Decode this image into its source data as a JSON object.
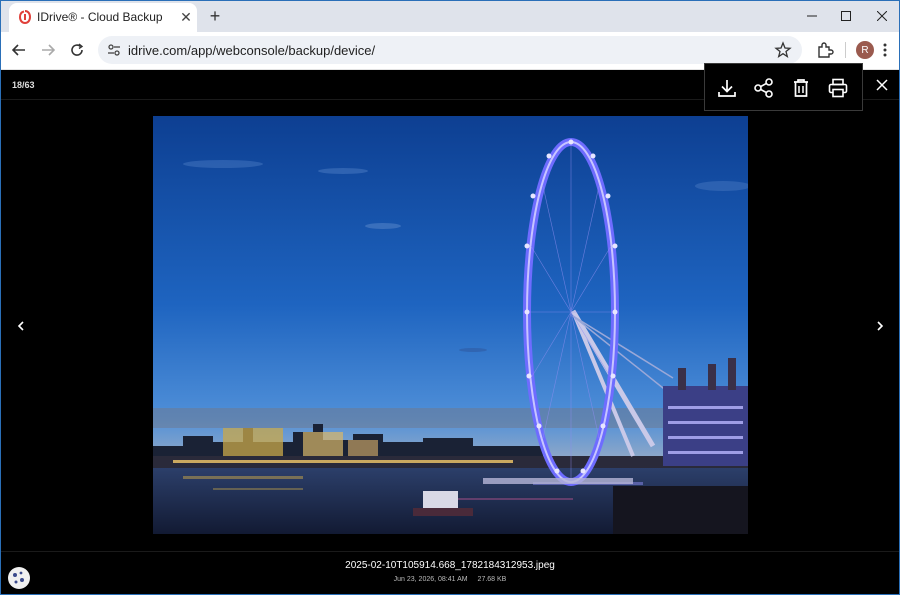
{
  "browser": {
    "tab": {
      "title": "IDrive® - Cloud Backup",
      "favicon": "idrive-logo-icon"
    },
    "url": "idrive.com/app/webconsole/backup/device/",
    "profile_initial": "R"
  },
  "viewer": {
    "counter": "18/63",
    "actions": [
      "download-icon",
      "share-icon",
      "delete-icon",
      "print-icon"
    ],
    "file": {
      "name": "2025-02-10T105914.668_1782184312953.jpeg",
      "date": "Jun 23, 2026, 08:41 AM",
      "size": "27.68 KB"
    }
  },
  "colors": {
    "accent": "#2a6fb8",
    "viewer_bg": "#000000"
  }
}
